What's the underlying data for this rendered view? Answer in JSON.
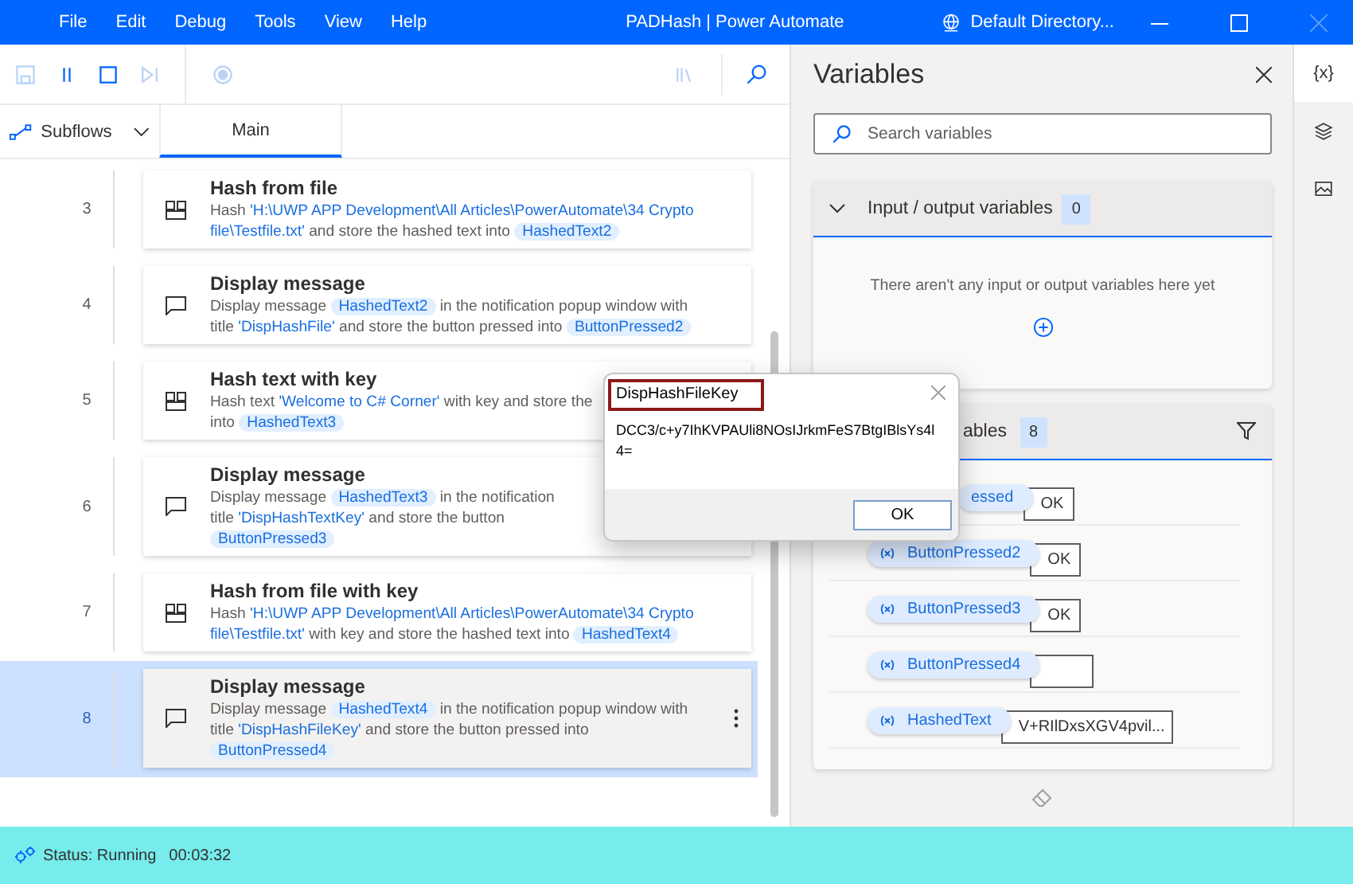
{
  "window": {
    "title": "PADHash | Power Automate",
    "account": "Default Directory...",
    "menu": [
      "File",
      "Edit",
      "Debug",
      "Tools",
      "View",
      "Help"
    ]
  },
  "toolbar": [
    {
      "kind": "save",
      "disabled": true
    },
    {
      "kind": "pause",
      "disabled": false
    },
    {
      "kind": "stop",
      "disabled": false
    },
    {
      "kind": "step",
      "disabled": true
    },
    {
      "kind": "record",
      "disabled": true
    }
  ],
  "tabs": {
    "subflows": "Subflows",
    "items": [
      {
        "label": "Main",
        "selected": true
      }
    ]
  },
  "steps": [
    {
      "number": "3",
      "title": "Hash from file",
      "kind": "hash",
      "selected": false,
      "lines": [
        [
          {
            "kind": "text",
            "text": "Hash "
          },
          {
            "kind": "link",
            "text": "'H:\\UWP APP Development\\All Articles\\PowerAutomate\\34 Crypto"
          }
        ],
        [
          {
            "kind": "link",
            "text": "file\\Testfile.txt'"
          },
          {
            "kind": "text",
            "text": " and store the hashed text into "
          },
          {
            "kind": "var",
            "text": "HashedText2"
          }
        ]
      ]
    },
    {
      "number": "4",
      "title": "Display message",
      "kind": "message",
      "selected": false,
      "lines": [
        [
          {
            "kind": "text",
            "text": "Display message "
          },
          {
            "kind": "var",
            "text": "HashedText2"
          },
          {
            "kind": "text",
            "text": " in the notification popup window with"
          }
        ],
        [
          {
            "kind": "text",
            "text": "title "
          },
          {
            "kind": "link",
            "text": "'DispHashFile'"
          },
          {
            "kind": "text",
            "text": " and store the button pressed into "
          },
          {
            "kind": "var",
            "text": "ButtonPressed2"
          }
        ]
      ]
    },
    {
      "number": "5",
      "title": "Hash text with key",
      "kind": "hash",
      "selected": false,
      "lines": [
        [
          {
            "kind": "text",
            "text": "Hash text "
          },
          {
            "kind": "link",
            "text": "'Welcome to C# Corner'"
          },
          {
            "kind": "text",
            "text": " with key and store the"
          }
        ],
        [
          {
            "kind": "text",
            "text": "into "
          },
          {
            "kind": "var",
            "text": "HashedText3"
          }
        ]
      ]
    },
    {
      "number": "6",
      "title": "Display message",
      "kind": "message",
      "selected": false,
      "lines": [
        [
          {
            "kind": "text",
            "text": "Display message "
          },
          {
            "kind": "var",
            "text": "HashedText3"
          },
          {
            "kind": "text",
            "text": " in the notification"
          }
        ],
        [
          {
            "kind": "text",
            "text": "title "
          },
          {
            "kind": "link",
            "text": "'DispHashTextKey'"
          },
          {
            "kind": "text",
            "text": " and store the button"
          }
        ],
        [
          {
            "kind": "var",
            "text": "ButtonPressed3"
          }
        ]
      ]
    },
    {
      "number": "7",
      "title": "Hash from file with key",
      "kind": "hash",
      "selected": false,
      "lines": [
        [
          {
            "kind": "text",
            "text": "Hash "
          },
          {
            "kind": "link",
            "text": "'H:\\UWP APP Development\\All Articles\\PowerAutomate\\34 Crypto"
          }
        ],
        [
          {
            "kind": "link",
            "text": "file\\Testfile.txt'"
          },
          {
            "kind": "text",
            "text": " with key and store the hashed text into "
          },
          {
            "kind": "var",
            "text": "HashedText4"
          }
        ]
      ]
    },
    {
      "number": "8",
      "title": "Display message",
      "kind": "message",
      "selected": true,
      "lines": [
        [
          {
            "kind": "text",
            "text": "Display message "
          },
          {
            "kind": "var",
            "text": "HashedText4"
          },
          {
            "kind": "text",
            "text": " in the notification popup window with"
          }
        ],
        [
          {
            "kind": "text",
            "text": "title "
          },
          {
            "kind": "link",
            "text": "'DispHashFileKey'"
          },
          {
            "kind": "text",
            "text": " and store the button pressed into"
          }
        ],
        [
          {
            "kind": "var",
            "text": "ButtonPressed4"
          }
        ]
      ]
    }
  ],
  "dialog": {
    "title": "DispHashFileKey",
    "message": "DCC3/c+y7IhKVPAUli8NOsIJrkmFeS7BtgIBlsYs4l4=",
    "button": "OK"
  },
  "variables": {
    "title": "Variables",
    "search": {
      "placeholder": "Search variables"
    },
    "io_section": {
      "label": "Input / output variables",
      "count": "0",
      "expanded": true,
      "empty_text": "There aren't any input or output variables here yet"
    },
    "flow_section": {
      "label": "ables",
      "count": "8",
      "items": [
        {
          "kind": "clipped",
          "name": "essed",
          "value": "OK"
        },
        {
          "kind": "full",
          "name": "ButtonPressed2",
          "value": "OK"
        },
        {
          "kind": "full",
          "name": "ButtonPressed3",
          "value": "OK"
        },
        {
          "kind": "full",
          "name": "ButtonPressed4"
        },
        {
          "kind": "full",
          "name": "HashedText",
          "value": "V+RIlDxsXGV4pvil..."
        }
      ]
    }
  },
  "side_tabs": [
    {
      "kind": "variables",
      "label": "{x}",
      "selected": true
    },
    {
      "kind": "layers",
      "selected": false
    },
    {
      "kind": "images",
      "selected": false
    }
  ],
  "status_bar": {
    "status": "Status: Running",
    "time": "00:03:32"
  }
}
